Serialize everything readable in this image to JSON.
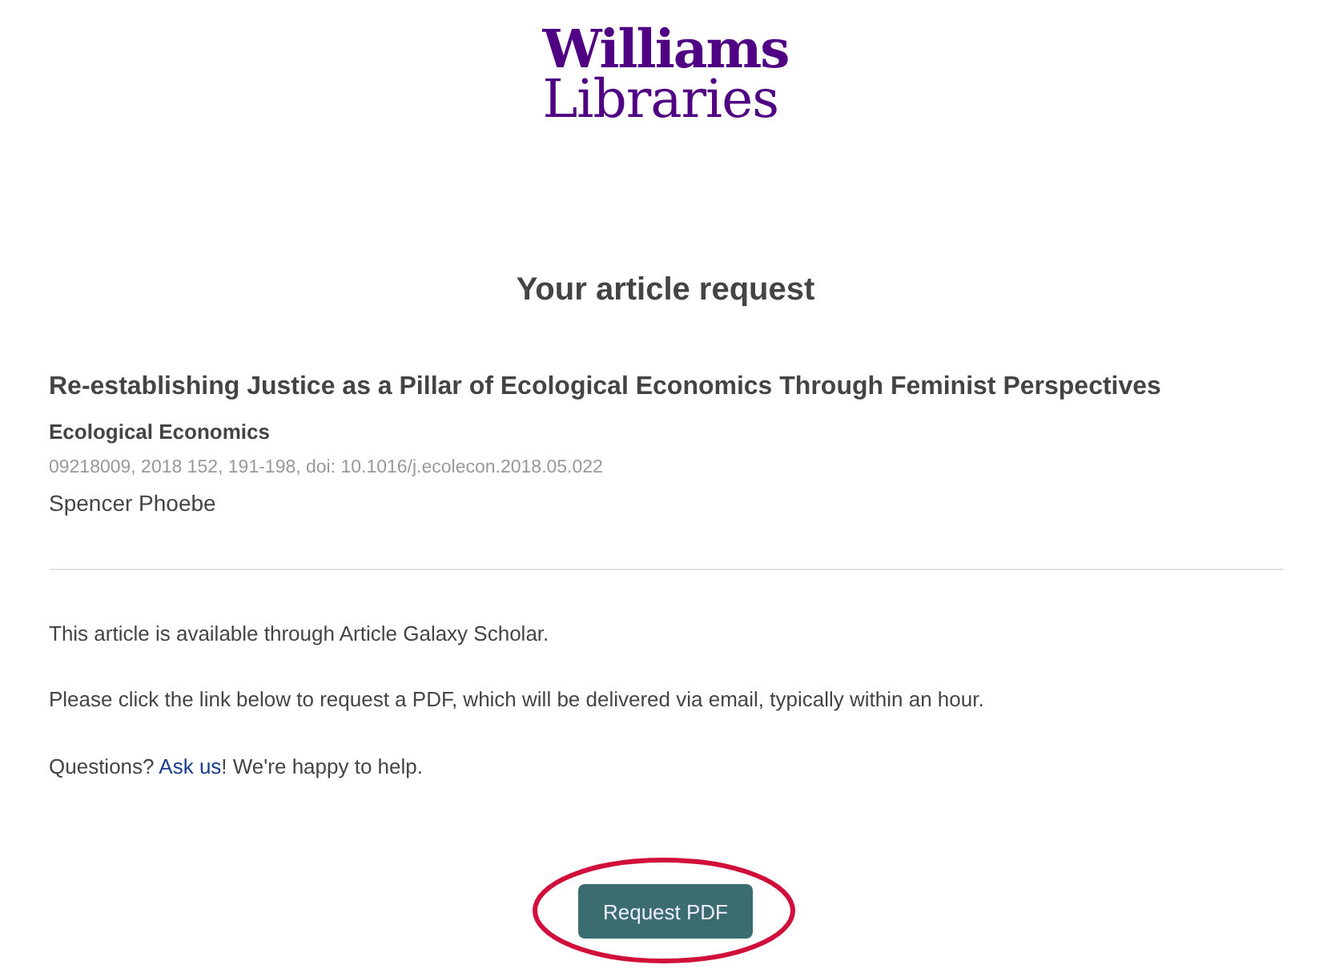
{
  "logo": {
    "line_1": "Williams",
    "line_2": "Libraries"
  },
  "heading": "Your article request",
  "article": {
    "title": "Re-establishing Justice as a Pillar of Ecological Economics Through Feminist Perspectives",
    "journal": "Ecological Economics",
    "citation": "09218009, 2018 152, 191-198, doi: 10.1016/j.ecolecon.2018.05.022",
    "author": "Spencer Phoebe"
  },
  "paragraphs": [
    "This article is available through Article Galaxy Scholar.",
    "Please click the link below to request a PDF, which will be delivered via email, typically within an hour."
  ],
  "questions": {
    "before": "Questions? ",
    "link": "Ask us",
    "after": "! We're happy to help."
  },
  "button": {
    "label": "Request PDF",
    "highlighted": true
  }
}
